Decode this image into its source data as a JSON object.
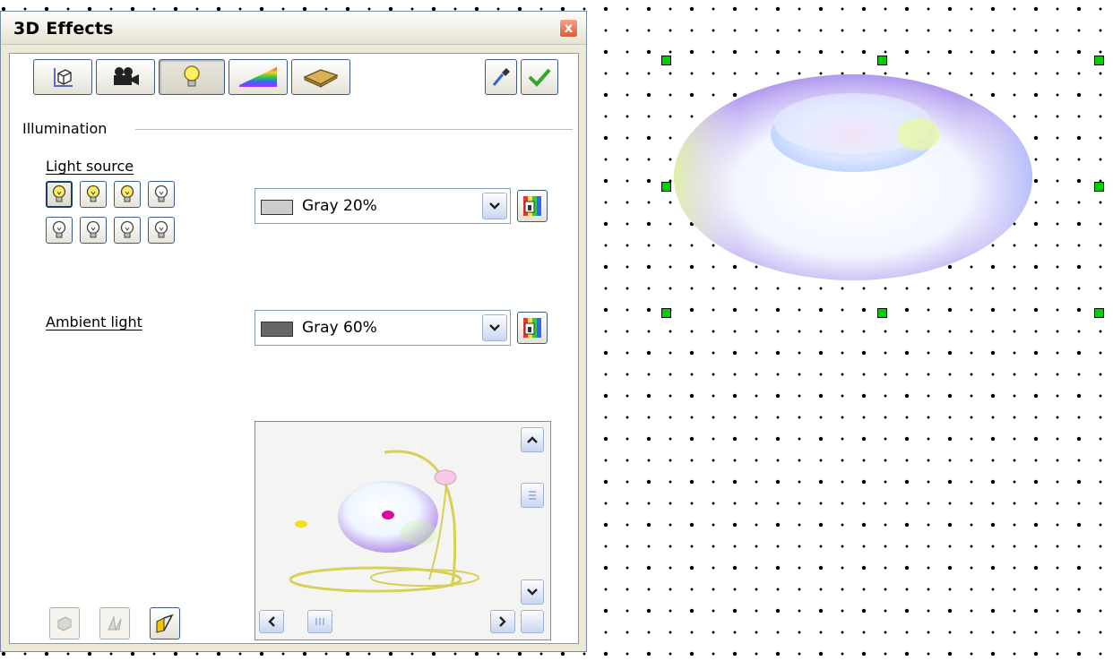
{
  "dialog": {
    "title": "3D Effects",
    "close_label": "x",
    "toolbar": {
      "tabs": [
        "geometry-icon",
        "shading-icon",
        "illumination-icon",
        "textures-icon",
        "material-icon"
      ],
      "active_tab": 2,
      "actions": [
        "assign-icon",
        "update-icon"
      ]
    },
    "illumination": {
      "section_label": "Illumination",
      "light_source": {
        "label": "Light source",
        "buttons_on": [
          true,
          true,
          true,
          false,
          false,
          false,
          false,
          false
        ],
        "selected_index": 0,
        "color_value": "Gray 20%",
        "color_hex": "#cccccc"
      },
      "ambient_light": {
        "label": "Ambient light",
        "color_value": "Gray 60%",
        "color_hex": "#666666"
      }
    },
    "bottom_buttons": [
      "convert-to-polygon-icon",
      "convert-to-3d-icon",
      "perspective-icon"
    ],
    "bottom_active_index": 2
  },
  "colors": {
    "dialog_bg": "#ece9d8",
    "close_red": "#e05a30",
    "handle_green": "#00d000"
  }
}
